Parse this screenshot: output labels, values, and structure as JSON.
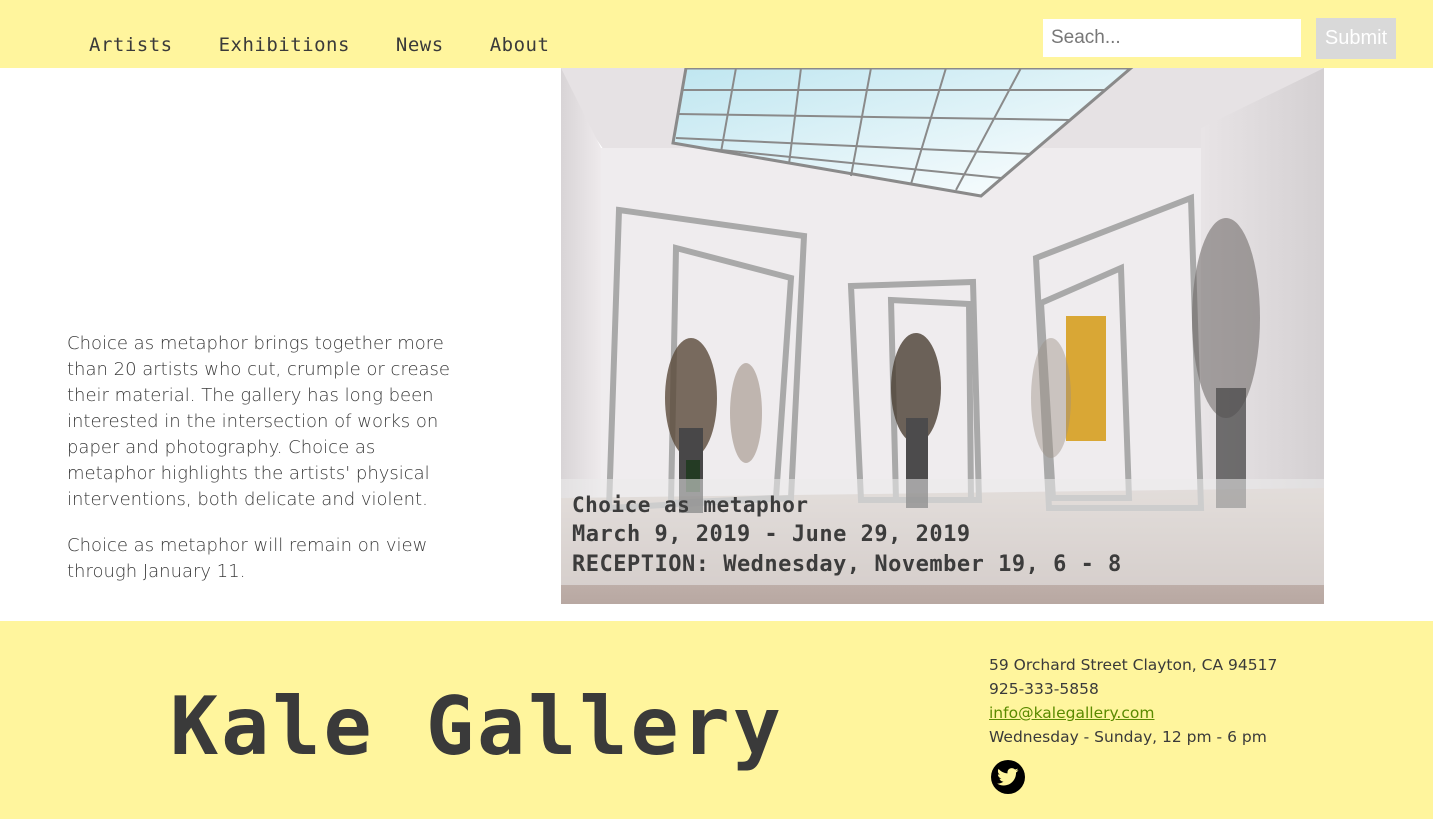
{
  "nav": {
    "items": [
      {
        "label": "Artists"
      },
      {
        "label": "Exhibitions"
      },
      {
        "label": "News"
      },
      {
        "label": "About"
      }
    ]
  },
  "search": {
    "placeholder": "Seach...",
    "value": "",
    "submit_label": "Submit"
  },
  "exhibition": {
    "paragraphs": [
      "Choice as metaphor brings together more than 20 artists who cut, crumple or crease their material. The gallery has long been interested in the intersection of works on paper and photography.  Choice as metaphor highlights the artists' physical interventions, both delicate and violent.",
      "Choice as metaphor will remain on view through January 11."
    ],
    "caption": {
      "title": "Choice as metaphor",
      "dates": "March 9, 2019 - June 29, 2019",
      "reception": "RECEPTION: Wednesday, November 19, 6 - 8"
    }
  },
  "footer": {
    "gallery_name": "Kale Gallery",
    "address": "59 Orchard Street Clayton, CA 94517",
    "phone": "925-333-5858",
    "email": "info@kalegallery.com",
    "hours": "Wednesday - Sunday, 12 pm - 6 pm",
    "social_icon": "twitter-icon"
  },
  "colors": {
    "header_bg": "#fff59d",
    "footer_bg": "#fff59d",
    "link": "#5a8a00",
    "text": "#3a3a3a"
  }
}
